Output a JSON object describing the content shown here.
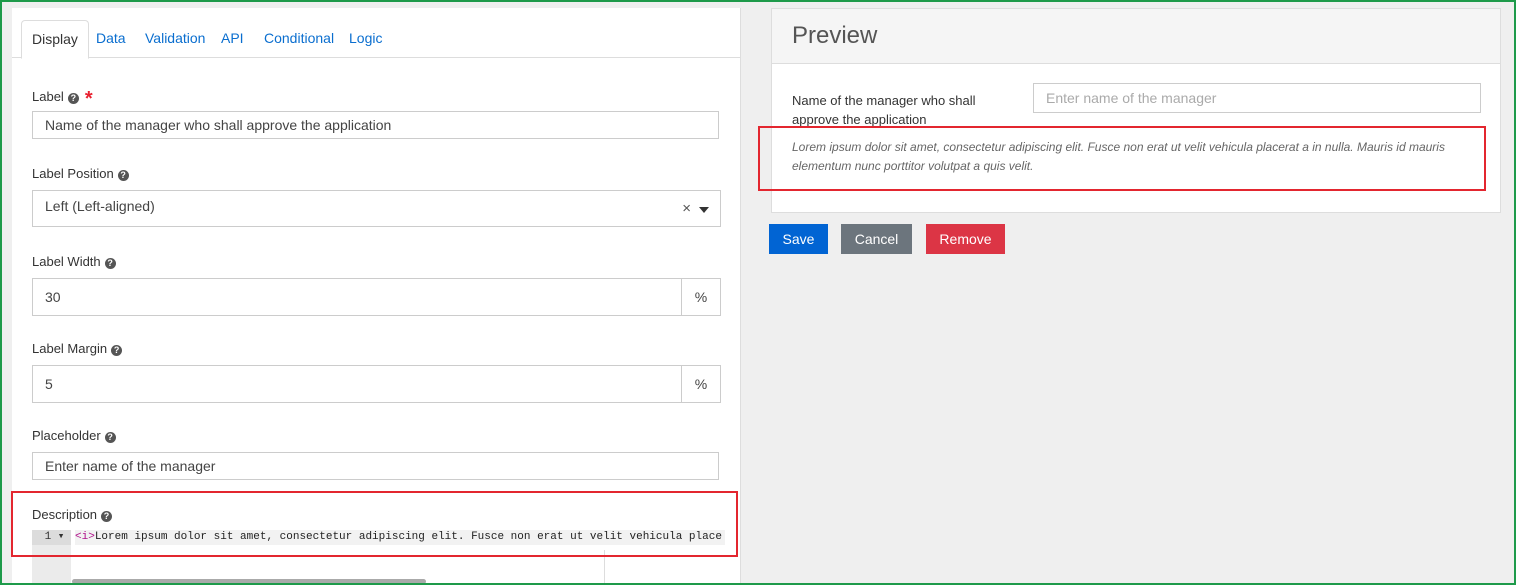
{
  "tabs": [
    "Display",
    "Data",
    "Validation",
    "API",
    "Conditional",
    "Logic"
  ],
  "label_field": {
    "label": "Label",
    "value": "Name of the manager who shall approve the application"
  },
  "label_position": {
    "label": "Label Position",
    "value": "Left (Left-aligned)",
    "clear_glyph": "×"
  },
  "label_width": {
    "label": "Label Width",
    "value": "30",
    "unit": "%"
  },
  "label_margin": {
    "label": "Label Margin",
    "value": "5",
    "unit": "%"
  },
  "placeholder_field": {
    "label": "Placeholder",
    "value": "Enter name of the manager"
  },
  "description": {
    "label": "Description",
    "line_number": "1",
    "code_tag": "<i>",
    "code_text": "Lorem ipsum dolor sit amet, consectetur adipiscing elit. Fusce non erat ut velit vehicula place"
  },
  "preview": {
    "title": "Preview",
    "field_label": "Name of the manager who shall approve the application",
    "field_placeholder": "Enter name of the manager",
    "description": "Lorem ipsum dolor sit amet, consectetur adipiscing elit. Fusce non erat ut velit vehicula placerat a in nulla. Mauris id mauris elementum nunc porttitor volutpat a quis velit."
  },
  "buttons": {
    "save": "Save",
    "cancel": "Cancel",
    "remove": "Remove"
  },
  "colors": {
    "save": "#0164d3",
    "cancel": "#6c757d",
    "remove": "#dc3545",
    "highlight": "#e3262f",
    "frame": "#1e9a4a"
  },
  "icons": {
    "help": "question-circle-icon",
    "required": "asterisk-icon"
  }
}
